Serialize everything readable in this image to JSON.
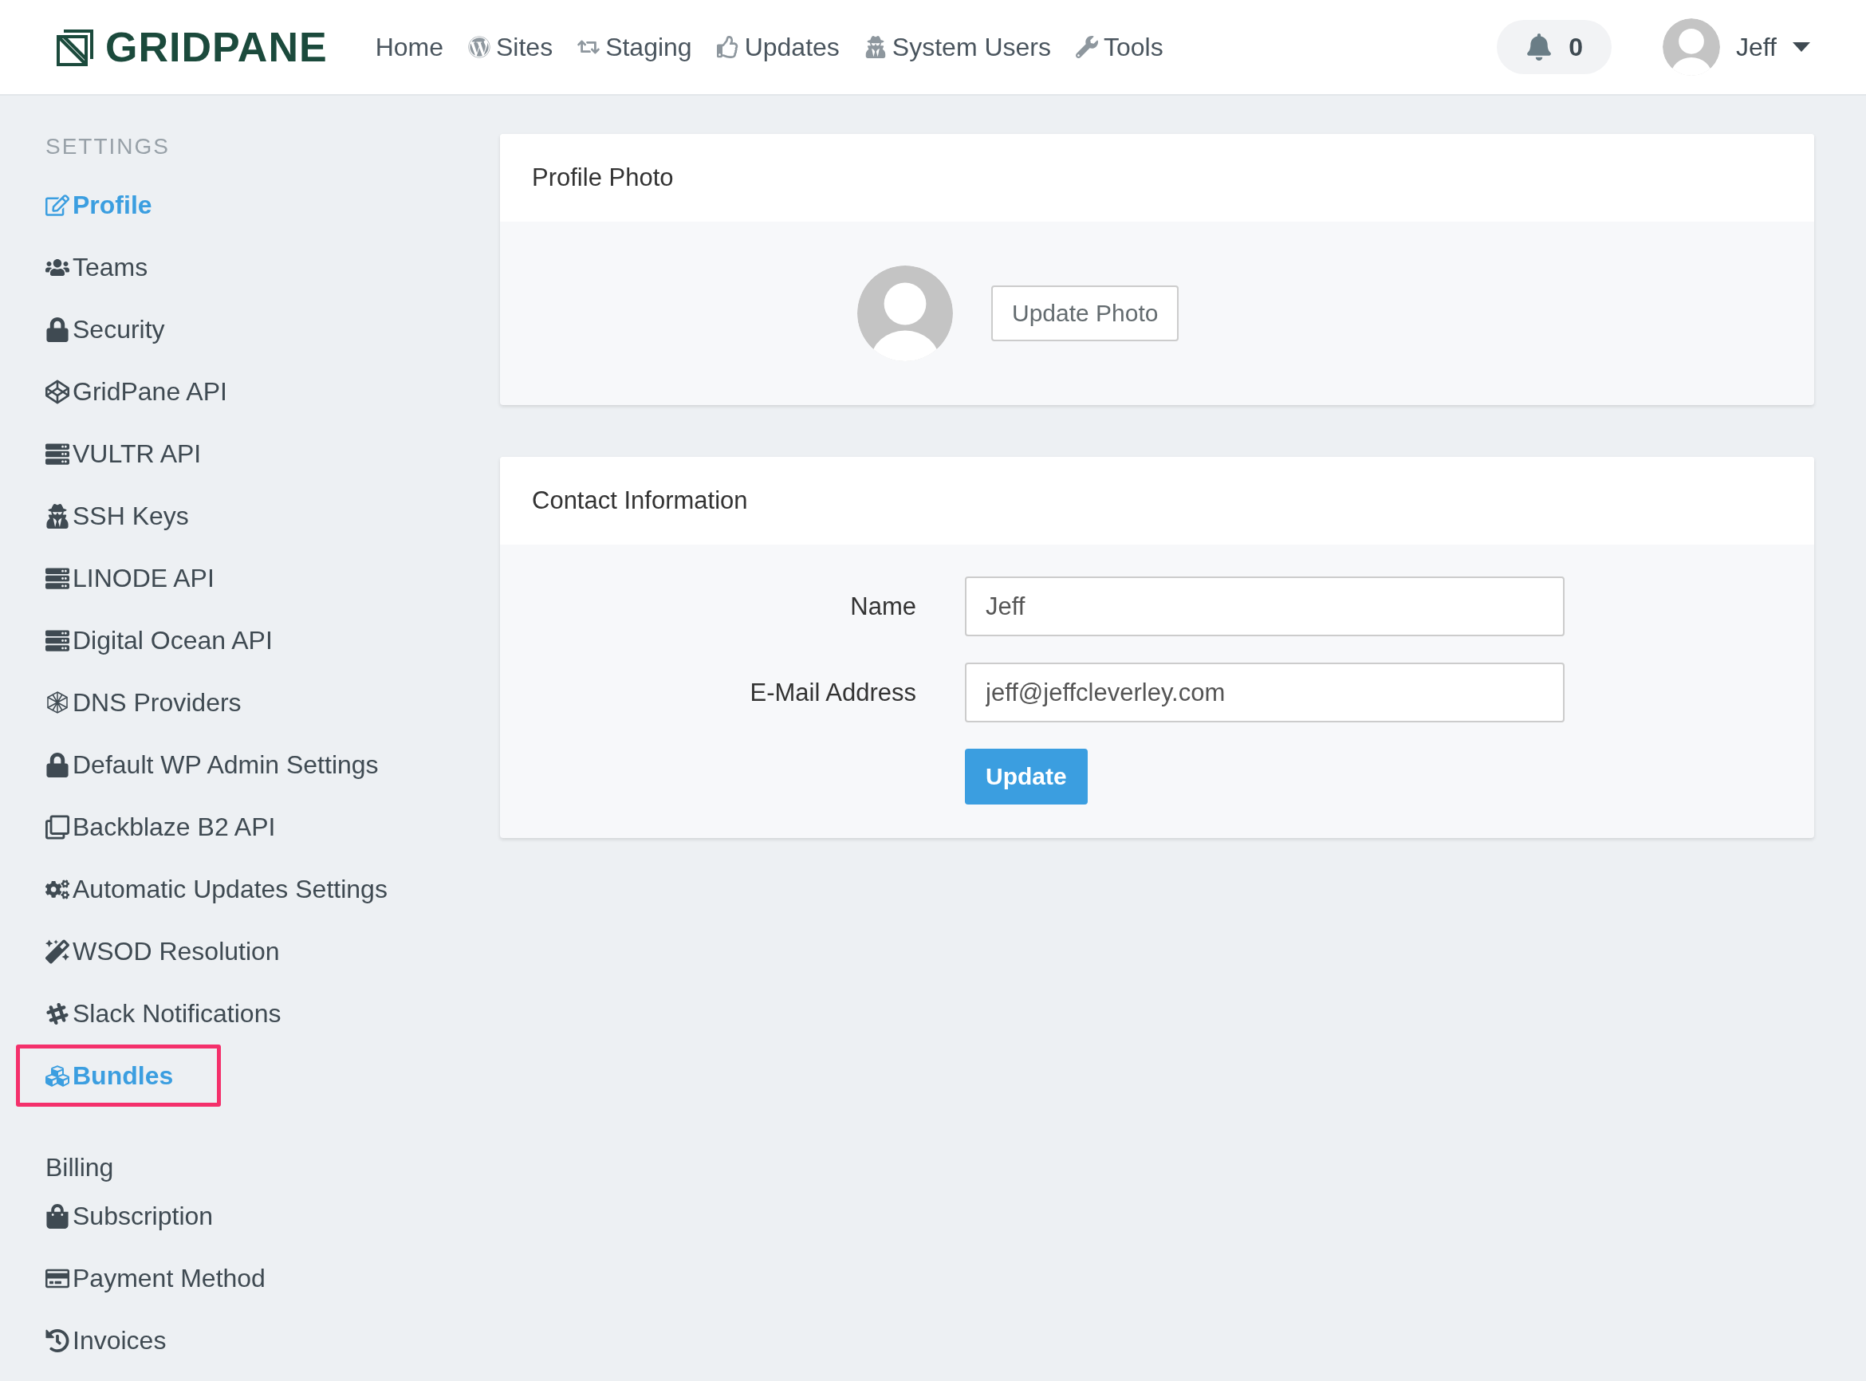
{
  "header": {
    "logo": "GRIDPANE",
    "nav": [
      {
        "label": "Home"
      },
      {
        "label": "Sites"
      },
      {
        "label": "Staging"
      },
      {
        "label": "Updates"
      },
      {
        "label": "System Users"
      },
      {
        "label": "Tools"
      }
    ],
    "notifications": {
      "count": "0"
    },
    "user": {
      "name": "Jeff"
    }
  },
  "sidebar": {
    "sections": [
      {
        "heading": "SETTINGS",
        "kind": "caps",
        "items": [
          {
            "label": "Profile",
            "selected": true,
            "highlighted": false
          },
          {
            "label": "Teams",
            "selected": false,
            "highlighted": false
          },
          {
            "label": "Security",
            "selected": false,
            "highlighted": false
          },
          {
            "label": "GridPane API",
            "selected": false,
            "highlighted": false
          },
          {
            "label": "VULTR API",
            "selected": false,
            "highlighted": false
          },
          {
            "label": "SSH Keys",
            "selected": false,
            "highlighted": false
          },
          {
            "label": "LINODE API",
            "selected": false,
            "highlighted": false
          },
          {
            "label": "Digital Ocean API",
            "selected": false,
            "highlighted": false
          },
          {
            "label": "DNS Providers",
            "selected": false,
            "highlighted": false
          },
          {
            "label": "Default WP Admin Settings",
            "selected": false,
            "highlighted": false
          },
          {
            "label": "Backblaze B2 API",
            "selected": false,
            "highlighted": false
          },
          {
            "label": "Automatic Updates Settings",
            "selected": false,
            "highlighted": false
          },
          {
            "label": "WSOD Resolution",
            "selected": false,
            "highlighted": false
          },
          {
            "label": "Slack Notifications",
            "selected": false,
            "highlighted": false
          },
          {
            "label": "Bundles",
            "selected": true,
            "highlighted": true
          }
        ]
      },
      {
        "heading": "Billing",
        "kind": "plain",
        "items": [
          {
            "label": "Subscription",
            "selected": false,
            "highlighted": false
          },
          {
            "label": "Payment Method",
            "selected": false,
            "highlighted": false
          },
          {
            "label": "Invoices",
            "selected": false,
            "highlighted": false
          }
        ]
      }
    ]
  },
  "profile_photo": {
    "title": "Profile Photo",
    "button": "Update Photo"
  },
  "contact": {
    "title": "Contact Information",
    "fields": [
      {
        "label": "Name",
        "value": "Jeff"
      },
      {
        "label": "E-Mail Address",
        "value": "jeff@jeffcleverley.com"
      }
    ],
    "button": "Update"
  }
}
